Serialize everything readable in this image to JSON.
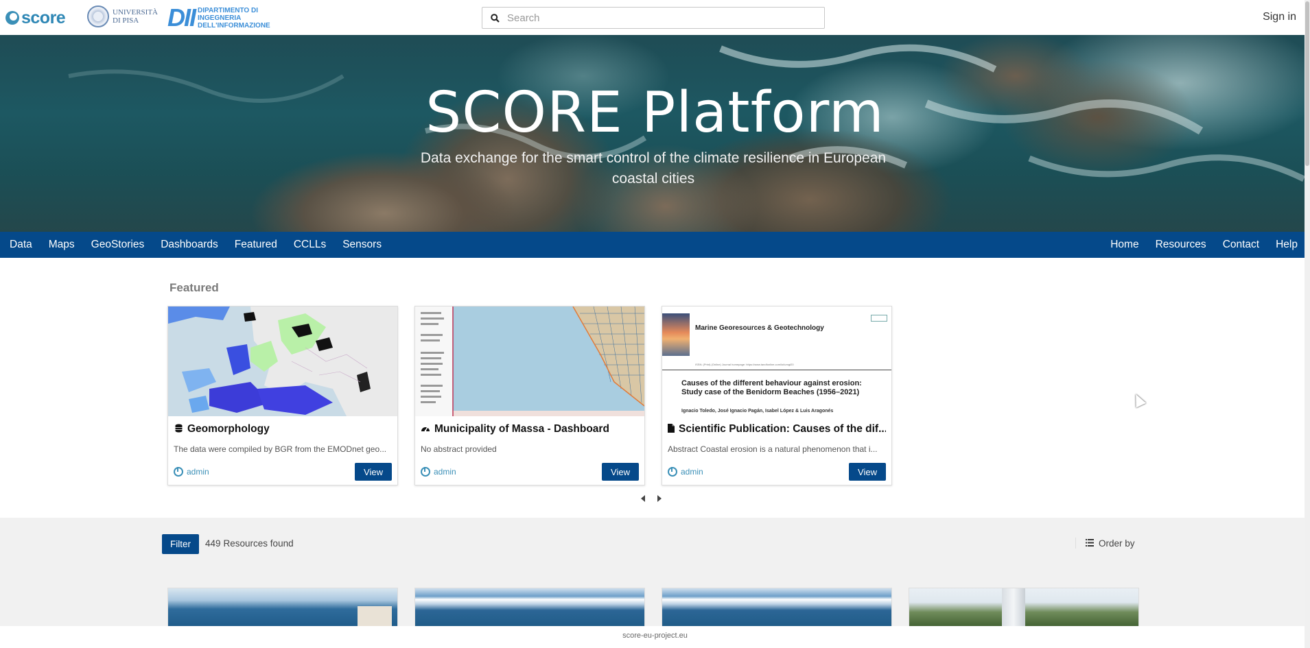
{
  "header": {
    "logo_score": "score",
    "logo_unipi_line1": "UNIVERSITÀ",
    "logo_unipi_line2": "DI PISA",
    "logo_dii_mark": "DII",
    "logo_dii_line1": "DIPARTIMENTO DI",
    "logo_dii_line2": "INGEGNERIA",
    "logo_dii_line3": "DELL'INFORMAZIONE",
    "search_placeholder": "Search",
    "sign_in": "Sign in"
  },
  "hero": {
    "title": "SCORE Platform",
    "subtitle": "Data exchange for the smart control of the climate resilience in European coastal cities"
  },
  "nav": {
    "left": [
      "Data",
      "Maps",
      "GeoStories",
      "Dashboards",
      "Featured",
      "CCLLs",
      "Sensors"
    ],
    "right": [
      "Home",
      "Resources",
      "Contact",
      "Help"
    ]
  },
  "featured": {
    "title": "Featured",
    "cards": [
      {
        "icon": "database-icon",
        "title": "Geomorphology",
        "abstract": "The data were compiled by BGR from the EMODnet geo...",
        "author": "admin",
        "action": "View"
      },
      {
        "icon": "dashboard-icon",
        "title": "Municipality of Massa - Dashboard",
        "abstract": "No abstract provided",
        "author": "admin",
        "action": "View"
      },
      {
        "icon": "document-icon",
        "title": "Scientific Publication: Causes of the dif...",
        "abstract": "Abstract Coastal erosion is a natural phenomenon that i...",
        "author": "admin",
        "action": "View"
      }
    ],
    "pub_thumb": {
      "journal": "Marine Georesources & Geotechnology",
      "issn": "ISSN: (Print) (Online) Journal homepage: https://www.tandfonline.com/loi/umgt20",
      "title": "Causes of the different behaviour against erosion: Study case of the Benidorm Beaches (1956–2021)",
      "authors": "Ignacio Toledo, José Ignacio Pagán, Isabel López & Luis Aragonés"
    }
  },
  "results": {
    "filter": "Filter",
    "count": "449",
    "count_label": "Resources found",
    "order_by": "Order by"
  },
  "footer": {
    "text": "score-eu-project.eu"
  },
  "colors": {
    "primary": "#05498a",
    "accent": "#3a8fb7"
  }
}
